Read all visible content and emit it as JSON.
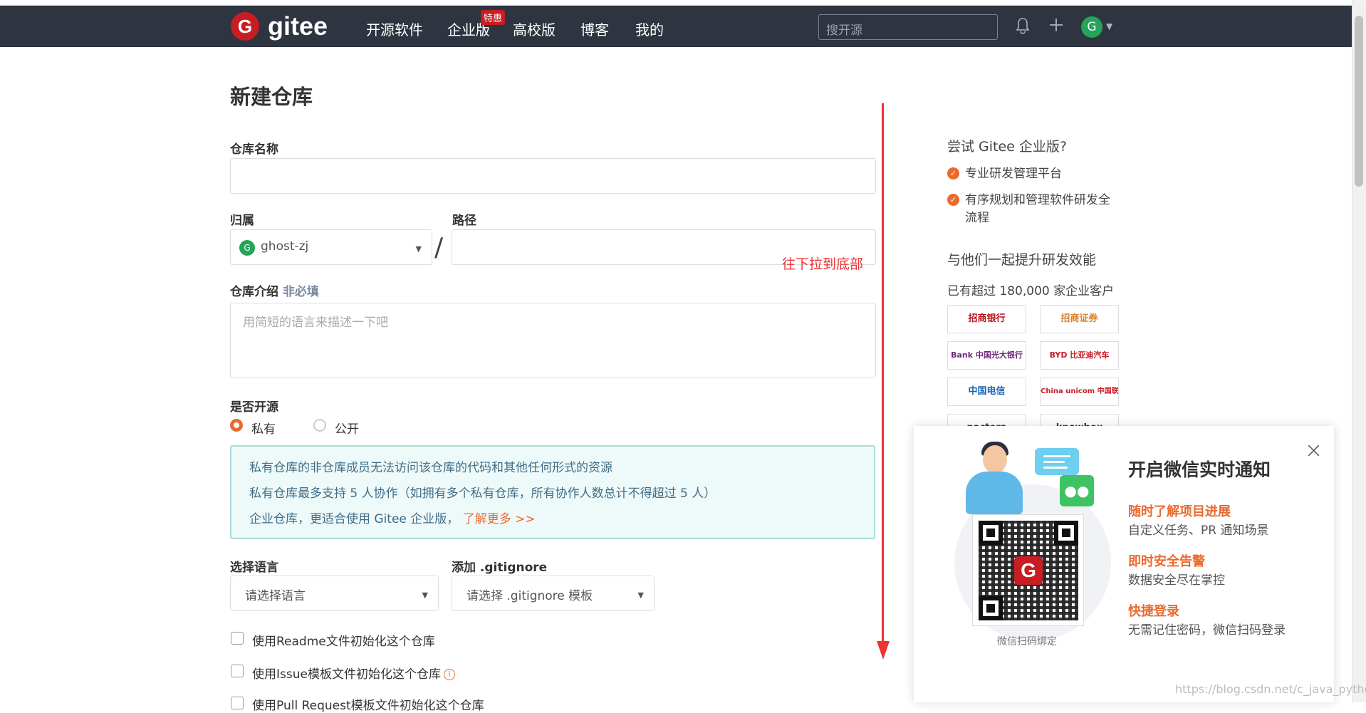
{
  "nav": {
    "logo_letter": "G",
    "logo_text": "gitee",
    "items": [
      "开源软件",
      "企业版",
      "高校版",
      "博客",
      "我的"
    ],
    "badge": "特惠",
    "search_placeholder": "搜开源",
    "avatar_letter": "G"
  },
  "form": {
    "title": "新建仓库",
    "repo_name_label": "仓库名称",
    "owner_label": "归属",
    "owner_avatar": "G",
    "owner_value": "ghost-zj",
    "path_label": "路径",
    "slash": "/",
    "desc_label": "仓库介绍",
    "desc_optional": "非必填",
    "desc_placeholder": "用简短的语言来描述一下吧",
    "visibility_label": "是否开源",
    "visibility_options": [
      "私有",
      "公开"
    ],
    "info_lines": [
      "私有仓库的非仓库成员无法访问该仓库的代码和其他任何形式的资源",
      "私有仓库最多支持 5 人协作（如拥有多个私有仓库，所有协作人数总计不得超过 5 人）",
      "企业仓库，更适合使用 Gitee 企业版，"
    ],
    "info_link": "了解更多 >>",
    "language_label": "选择语言",
    "language_placeholder": "请选择语言",
    "gitignore_label": "添加 .gitignore",
    "gitignore_placeholder": "请选择 .gitignore 模板",
    "checkboxes": [
      "使用Readme文件初始化这个仓库",
      "使用Issue模板文件初始化这个仓库",
      "使用Pull Request模板文件初始化这个仓库"
    ]
  },
  "annotation": "往下拉到底部",
  "sidebar": {
    "try_title": "尝试 Gitee 企业版?",
    "features": [
      "专业研发管理平台",
      "有序规划和管理软件研发全流程"
    ],
    "join_title": "与他们一起提升研发效能",
    "customers": "已有超过 180,000 家企业客户",
    "logos": [
      "招商银行",
      "招商证券",
      "Bank 中国光大银行",
      "BYD 比亚迪汽车",
      "中国电信",
      "China unicom 中国联通",
      "pactera",
      "knowbox"
    ]
  },
  "popup": {
    "title": "开启微信实时通知",
    "items": [
      {
        "h": "随时了解项目进展",
        "d": "自定义任务、PR 通知场景"
      },
      {
        "h": "即时安全告警",
        "d": "数据安全尽在掌控"
      },
      {
        "h": "快捷登录",
        "d": "无需记住密码，微信扫码登录"
      }
    ],
    "qr_caption": "微信扫码绑定",
    "qr_letter": "G",
    "close": "×"
  },
  "watermark": "https://blog.csdn.net/c_java_python",
  "colors": {
    "accent": "#ea6a2e",
    "brand": "#c71d23",
    "nav_bg": "#2e3440",
    "annotation": "#ee3333"
  }
}
